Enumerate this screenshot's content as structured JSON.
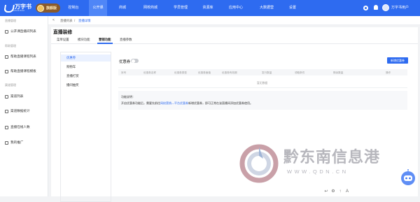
{
  "app": {
    "logo_text": "万字书",
    "logo_sub": "WANZISHU",
    "edition_label": "旗舰版",
    "user_name": "万字书用户",
    "colors": {
      "brand": "#2e6bf0",
      "nav_active": "#4f86f7",
      "edition_bg": "#8a5a2b"
    }
  },
  "nav": [
    "控制台",
    "公开课",
    "商城",
    "网校商城",
    "学员管理",
    "资源库",
    "应用中心",
    "大数据营",
    "设置"
  ],
  "sidebar": {
    "group1": "直播管理",
    "item1": "公开课直播间列表",
    "group2": "帮助管理",
    "item2": "帮助直播课程列表",
    "item3": "帮助直播课程模板",
    "group3": "渠道管理",
    "item4": "渠道列表",
    "item5": "渠道数据统计",
    "item6": "直播在线人数",
    "item7": "我的推广"
  },
  "breadcrumb": {
    "back": "<",
    "c1": "直播列表",
    "sep": "/",
    "c2": "直播详情"
  },
  "page": {
    "title": "直播装修",
    "tabs": [
      "菜单设置",
      "模块功能",
      "营销功能",
      "直播参数"
    ],
    "active_tab_index": 2
  },
  "left_menu": [
    "优惠券",
    "购物车",
    "直播打赏",
    "播间抽奖"
  ],
  "main": {
    "section_title": "优惠券",
    "toggle_on": false,
    "add_button": "新增优惠券",
    "columns": [
      "序号",
      "优惠券名称",
      "优惠券类型",
      "优惠券面值",
      "优惠券有效期",
      "发行数量",
      "领取条件",
      "剩余数量",
      "操作"
    ],
    "empty_text": "暂无数据",
    "notice_title": "功能说明：",
    "notice_prefix": "开启优惠券功能后，需要先前往",
    "notice_link": "网校营销—平台优惠券",
    "notice_suffix": "新增优惠券，即可正常在该直播间添加优惠券使用。"
  },
  "watermark": {
    "text": "黔东南信息港",
    "url": "WWW.QDN.CN"
  },
  "bottom_tools": [
    "↩",
    "⚙",
    "↑",
    "A"
  ]
}
